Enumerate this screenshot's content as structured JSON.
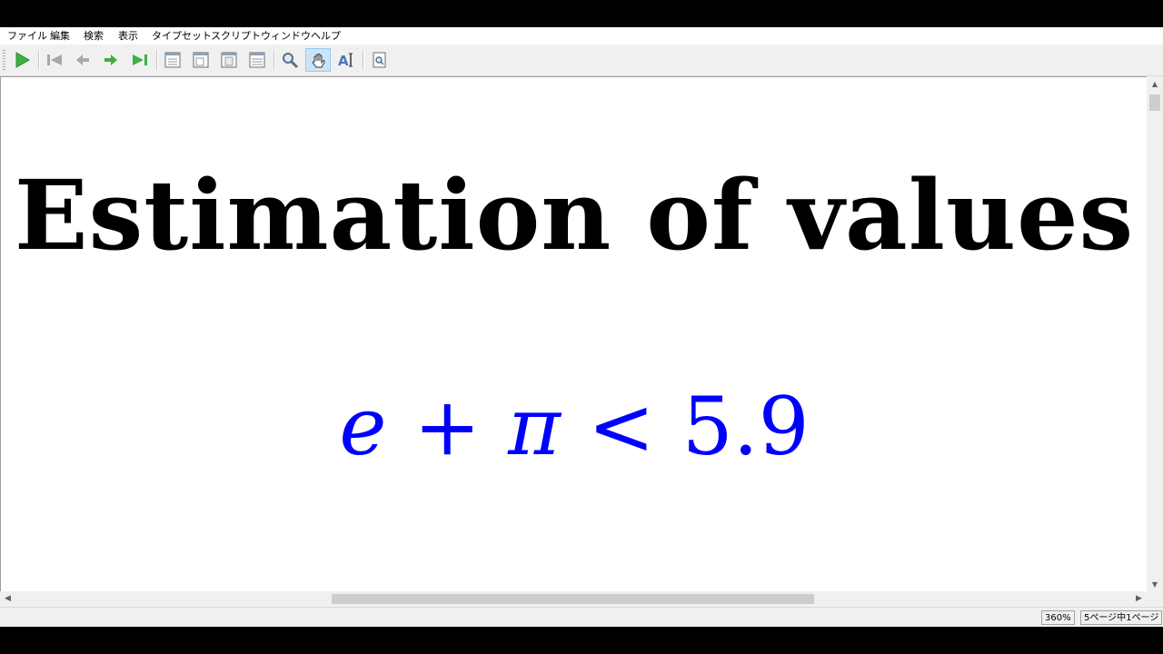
{
  "menu": [
    {
      "label": "ファイル"
    },
    {
      "label": "編集"
    },
    {
      "label": "検索"
    },
    {
      "label": "表示"
    },
    {
      "label": "タイプセット"
    },
    {
      "label": "スクリプト"
    },
    {
      "label": "ウィンドウ"
    },
    {
      "label": "ヘルプ"
    }
  ],
  "toolbar": {
    "buttons": [
      {
        "icon": "play-icon",
        "color": "#3cb043"
      },
      {
        "icon": "first-page-icon",
        "color": "#a8a8a8"
      },
      {
        "icon": "previous-page-icon",
        "color": "#a8a8a8"
      },
      {
        "icon": "next-page-icon",
        "color": "#3cb043"
      },
      {
        "icon": "last-page-icon",
        "color": "#3cb043"
      },
      {
        "icon": "single-page-view-icon"
      },
      {
        "icon": "continuous-view-icon"
      },
      {
        "icon": "facing-pages-icon"
      },
      {
        "icon": "fit-width-icon"
      },
      {
        "icon": "magnifier-icon"
      },
      {
        "icon": "hand-tool-icon",
        "active": true
      },
      {
        "icon": "text-select-icon"
      },
      {
        "icon": "find-in-document-icon"
      }
    ]
  },
  "document": {
    "heading": "Estimation of values",
    "formula": {
      "lhs_var1": "e",
      "op1": "+",
      "lhs_var2": "π",
      "op2": "<",
      "rhs": "5.9",
      "color": "#0000ff"
    }
  },
  "status": {
    "zoom": "360%",
    "page": "5ページ中1ページ"
  }
}
